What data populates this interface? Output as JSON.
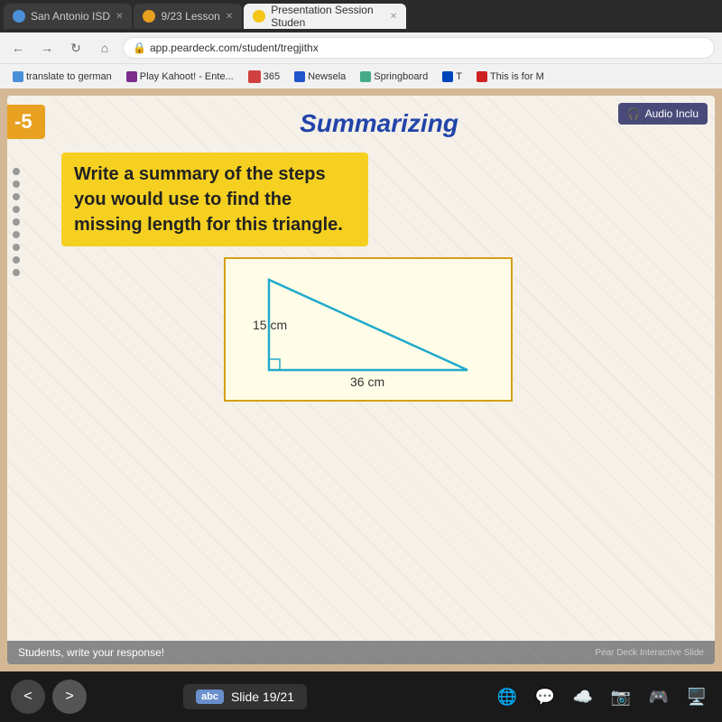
{
  "browser": {
    "tabs": [
      {
        "id": "tab1",
        "label": "San Antonio ISD",
        "active": false,
        "favicon_color": "#4a90d9"
      },
      {
        "id": "tab2",
        "label": "9/23 Lesson",
        "active": false,
        "favicon_color": "#e8a020"
      },
      {
        "id": "tab3",
        "label": "Presentation Session Studen",
        "active": true,
        "favicon_color": "#f5c518"
      }
    ],
    "url": "app.peardeck.com/student/tregjithx",
    "bookmarks": [
      {
        "label": "translate to german",
        "favicon_color": "#4a90d9"
      },
      {
        "label": "Play Kahoot! - Ente...",
        "favicon_color": "#7b2d8b"
      },
      {
        "label": "365",
        "favicon_color": "#d04040"
      },
      {
        "label": "Newsela",
        "favicon_color": "#2255cc"
      },
      {
        "label": "Springboard",
        "favicon_color": "#44aa88"
      },
      {
        "label": "T",
        "favicon_color": "#0044bb"
      },
      {
        "label": "This is for M",
        "favicon_color": "#cc2222"
      }
    ]
  },
  "slide": {
    "number": "-5",
    "title": "Summarizing",
    "prompt": "Write a summary of the steps you would use to find the missing length for this triangle.",
    "triangle": {
      "side1_label": "15 cm",
      "side2_label": "36 cm"
    },
    "audio_button": "Audio Inclu",
    "bottom_prompt": "Students, write your response!",
    "peardeck_label": "Pear Deck Interactive Slide"
  },
  "navigation": {
    "prev_label": "<",
    "next_label": ">",
    "slide_badge": "abc",
    "slide_current": "19",
    "slide_total": "21",
    "slide_text": "Slide 19/21"
  },
  "taskbar_icons": [
    "🌐",
    "💬",
    "☁",
    "📷",
    "🎮",
    "🖥"
  ]
}
